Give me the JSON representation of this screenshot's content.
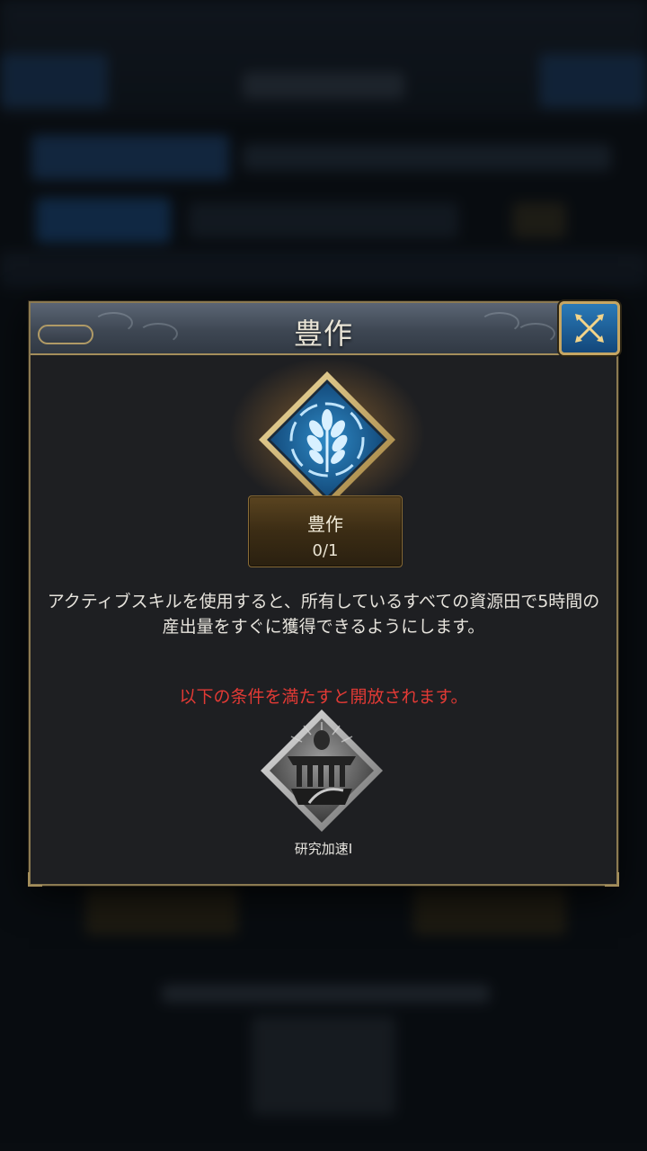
{
  "dialog": {
    "title": "豊作",
    "close_icon": "close-x-icon"
  },
  "skill": {
    "icon": "wheat-emblem-icon",
    "name": "豊作",
    "level": "0/1",
    "description": "アクティブスキルを使用すると、所有しているすべての資源田で5時間の産出量をすぐに獲得できるようにします。"
  },
  "requirement": {
    "condition_text": "以下の条件を満たすと開放されます。",
    "icon": "research-speedup-icon",
    "name": "研究加速I"
  },
  "colors": {
    "condition": "#e23a35",
    "close_button": "#1f5f96",
    "border_gold": "#a48e5b"
  }
}
